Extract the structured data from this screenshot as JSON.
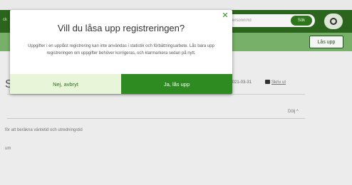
{
  "header": {
    "left_text": "ck",
    "search_placeholder": "Personnr/id",
    "search_button": "Sök"
  },
  "subbar": {
    "unlock_button": "Lås upp"
  },
  "content": {
    "heading_fragment": "S",
    "date_text": "ad 2021-03-31",
    "print_label": "Skriv ut",
    "hide_toggle": "Dölj ^",
    "info_line": "för att beräkna väntetid och utredningstid",
    "info_line_2": "um"
  },
  "modal": {
    "title": "Vill du låsa upp registreringen?",
    "body": "Uppgifter i en upplåst registrering kan inte användas i statistik och förbättringsarbete. Lås bara upp registreringen om uppgifter behöver korrigeras, och klarmarkera sedan på nytt.",
    "cancel_label": "Nej, avbryt",
    "confirm_label": "Ja, lås upp",
    "close_icon": "close-icon"
  },
  "colors": {
    "topbar": "#2d6a1f",
    "subbar": "#7cb86e",
    "accent": "#2e8b22",
    "cancel_bg": "#e8f5d9"
  }
}
